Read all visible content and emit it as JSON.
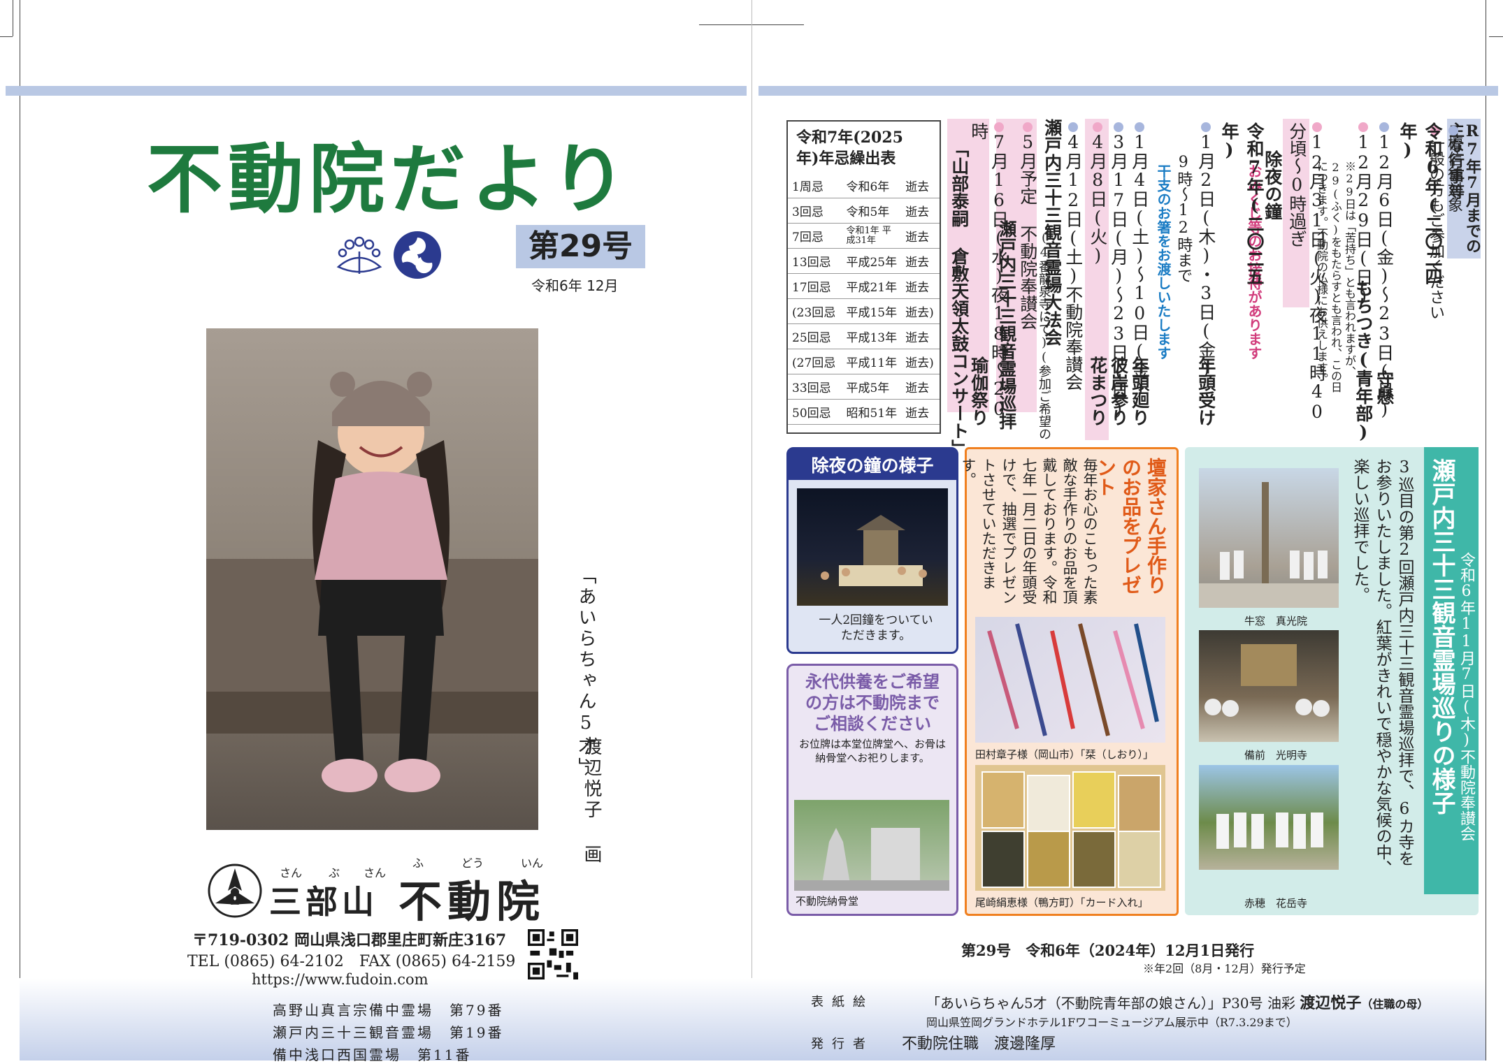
{
  "left": {
    "masthead": "不動院だより",
    "issue": "第29号",
    "issue_date": "令和6年 12月",
    "painting_caption": "「あいらちゃん5才」",
    "painting_artist": "渡辺悦子 画",
    "temple": {
      "mountain": "三部山",
      "name": "不動院",
      "ruby_san": "さん",
      "ruby_bu": "ぶ",
      "ruby_san2": "さん",
      "ruby_fu": "ふ",
      "ruby_dou": "どう",
      "ruby_in": "いん"
    },
    "address": "〒719-0302 岡山県浅口郡里庄町新庄3167",
    "tel_fax": "TEL (0865) 64-2102　FAX (0865) 64-2159",
    "url": "https://www.fudoin.com",
    "registrations": [
      "高野山真言宗備中霊場　第79番",
      "瀬戸内三十三観音霊場　第19番",
      "備中浅口西国霊場　第11番"
    ]
  },
  "right": {
    "schedule_title": "R7年7月までの主な行事等",
    "legend_blue": "檀信徒対象",
    "legend_pink": "一般の方もご参加ください",
    "year_2024": "令和6年(二〇二四年)",
    "events_2024": [
      {
        "dot": "blue",
        "date": "12月6日(金)〜23日(月)",
        "name": "守懸"
      },
      {
        "dot": "pink",
        "date": "12月29日(日)",
        "name": "もちつき(青年部)"
      },
      {
        "dot": "pink",
        "date": "12月31日(火)夜11時40分頃〜0時過ぎ",
        "name": "除夜の鐘"
      }
    ],
    "note_29": "※29日は「苦持ち」とも言われますが、29(ふく)をもたらすとも言われ、この日につきます。不動院の仏様にお供えします。",
    "omikuji": "おみくじ等のお接待があります",
    "year_2025": "令和7年(二〇二五年)",
    "events_2025": [
      {
        "dot": "blue",
        "date": "1月2日(木)・3日(金)",
        "name": "年頭受け"
      },
      {
        "dot": "blue",
        "date": "9時〜12時まで",
        "name": ""
      },
      {
        "dot": "blue",
        "date": "1月4日(土)〜10日(金)",
        "name": "年頭廻り"
      },
      {
        "dot": "blue",
        "date": "3月17日(月)〜23日(日)",
        "name": "彼岸参り"
      },
      {
        "dot": "pink",
        "date": "4月8日(火)",
        "name": "花まつり"
      },
      {
        "dot": "blue",
        "date": "4月12日(土)不動院奉讃会",
        "name": "瀬戸内三十三観音霊場大法会"
      },
      {
        "dot": "pink",
        "date": "5月予定 不動院奉讃会",
        "name": "瀬戸内三十三観音霊場巡拝"
      },
      {
        "dot": "pink",
        "date": "7月16日(水)夜18時〜20時",
        "name": "瑜伽祭り"
      }
    ],
    "eto_note": "干支のお箸をお渡しいたします",
    "hoe_note": "(4番龍泉寺にて)(参加ご希望の方は不動院まで)",
    "concert": "「山部泰嗣 倉敷天領太鼓コンサート」",
    "nenki": {
      "title": "令和7年(2025年)年忌繰出表",
      "rows": [
        [
          "1周忌",
          "令和6年",
          "逝去"
        ],
        [
          "3回忌",
          "令和5年",
          "逝去"
        ],
        [
          "7回忌",
          "令和1年 平成31年",
          "逝去"
        ],
        [
          "13回忌",
          "平成25年",
          "逝去"
        ],
        [
          "17回忌",
          "平成21年",
          "逝去"
        ],
        [
          "(23回忌",
          "平成15年",
          "逝去)"
        ],
        [
          "25回忌",
          "平成13年",
          "逝去"
        ],
        [
          "(27回忌",
          "平成11年",
          "逝去)"
        ],
        [
          "33回忌",
          "平成5年",
          "逝去"
        ],
        [
          "50回忌",
          "昭和51年",
          "逝去"
        ]
      ]
    },
    "joya": {
      "title": "除夜の鐘の様子",
      "caption": "一人2回鐘をついていただきます。"
    },
    "eitai": {
      "title": "永代供養をご希望の方は不動院までご相談ください",
      "text": "お位牌は本堂位牌堂へ、お骨は納骨堂へお祀りします。",
      "photo_caption": "不動院納骨堂"
    },
    "present": {
      "title": "壇家さん手作りのお品をプレゼント",
      "text": "毎年お心のこもった素敵な手作りのお品を頂戴しております。令和七年一月二日の年頭受けで、抽選でプレゼントさせていただきます。",
      "caption1": "田村章子様（岡山市）「栞（しおり）」",
      "caption2": "尾崎絹恵様（鴨方町）「カード入れ」"
    },
    "junpai": {
      "title": "瀬戸内三十三観音霊場巡りの様子",
      "subtitle": "令和6年11月7日(木)不動院奉讃会",
      "text": "3巡目の第2回瀬戸内三十三観音霊場巡拝で、6カ寺をお参りいたしました。紅葉がきれいで穏やかな気候の中、楽しい巡拝でした。",
      "captions": [
        "牛窓　真光院",
        "備前　光明寺",
        "赤穂　花岳寺"
      ]
    },
    "publication": "第29号　令和6年（2024年）12月1日発行",
    "publication_note": "※年2回（8月・12月）発行予定",
    "credits": {
      "cover_label": "表紙絵",
      "cover_text": "「あいらちゃん5才（不動院青年部の娘さん）」P30号 油彩",
      "cover_artist": "渡辺悦子",
      "cover_relation": "（住職の母）",
      "exhibit": "岡山県笠岡グランドホテル1Fワコーミュージアム展示中（R7.3.29まで）",
      "publisher_label": "発行者",
      "publisher": "不動院住職　渡邊隆厚"
    }
  },
  "colors": {
    "masthead_green": "#1e7a3e",
    "band_blue": "#b9c8e4",
    "pink": "#f0a8c8",
    "blue_dot": "#a7b6dd",
    "teal": "#3fb7a8",
    "orange": "#f08020",
    "purple": "#7a5ca8",
    "navy": "#2b3a8f"
  }
}
